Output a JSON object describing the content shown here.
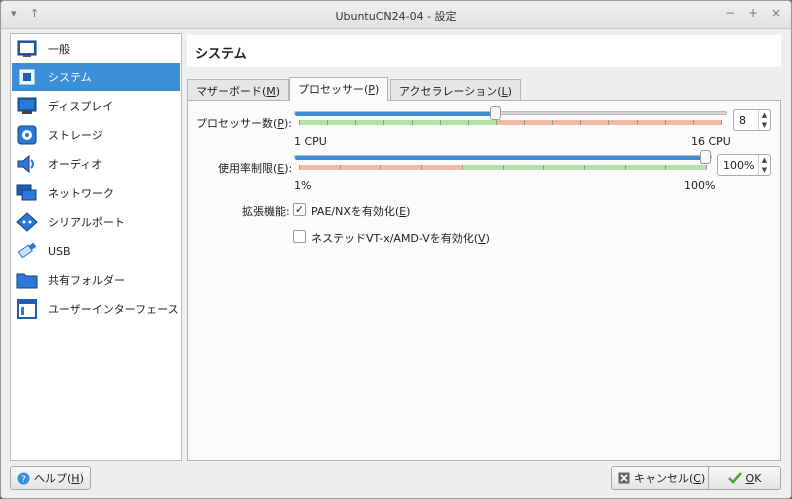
{
  "window": {
    "title": "UbuntuCN24-04 - 設定",
    "controls": {
      "minimize": "−",
      "maximize": "+",
      "close": "×",
      "menu": "▾",
      "up": "↑"
    }
  },
  "sidebar": {
    "items": [
      {
        "label": "一般",
        "icon": "general-icon",
        "selected": false
      },
      {
        "label": "システム",
        "icon": "system-chip-icon",
        "selected": true
      },
      {
        "label": "ディスプレイ",
        "icon": "display-icon",
        "selected": false
      },
      {
        "label": "ストレージ",
        "icon": "storage-disk-icon",
        "selected": false
      },
      {
        "label": "オーディオ",
        "icon": "audio-speaker-icon",
        "selected": false
      },
      {
        "label": "ネットワーク",
        "icon": "network-icon",
        "selected": false
      },
      {
        "label": "シリアルポート",
        "icon": "serial-port-icon",
        "selected": false
      },
      {
        "label": "USB",
        "icon": "usb-icon",
        "selected": false
      },
      {
        "label": "共有フォルダー",
        "icon": "shared-folder-icon",
        "selected": false
      },
      {
        "label": "ユーザーインターフェース",
        "icon": "user-interface-icon",
        "selected": false
      }
    ]
  },
  "header": {
    "title": "システム"
  },
  "tabs": [
    {
      "label": "マザーボード(",
      "mnemonic": "M",
      "suffix": ")",
      "active": false
    },
    {
      "label": "プロセッサー(",
      "mnemonic": "P",
      "suffix": ")",
      "active": true
    },
    {
      "label": "アクセラレーション(",
      "mnemonic": "L",
      "suffix": ")",
      "active": false
    }
  ],
  "processor": {
    "label": "プロセッサー数(",
    "mnemonic": "P",
    "suffix": "):",
    "value": "8",
    "min_label": "1 CPU",
    "max_label": "16 CPU",
    "min": 1,
    "max": 16,
    "current": 8
  },
  "execution_cap": {
    "label": "使用率制限(",
    "mnemonic": "E",
    "suffix": "):",
    "value": "100%",
    "min_label": "1%",
    "max_label": "100%",
    "min": 1,
    "max": 100,
    "current": 100
  },
  "extended": {
    "label": "拡張機能:",
    "pae": {
      "label": "PAE/NXを有効化(",
      "mnemonic": "E",
      "suffix": ")",
      "checked": true,
      "mark": "✓"
    },
    "nested": {
      "label": "ネステッドVT-x/AMD-Vを有効化(",
      "mnemonic": "V",
      "suffix": ")",
      "checked": false
    }
  },
  "footer": {
    "help": {
      "label": "ヘルプ(",
      "mnemonic": "H",
      "suffix": ")"
    },
    "cancel": {
      "label": "キャンセル(",
      "mnemonic": "C",
      "suffix": ")"
    },
    "ok": {
      "label": "",
      "mnemonic": "O",
      "suffix": "K"
    }
  },
  "colors": {
    "accent": "#3b8ed8",
    "zone_green": "#aee6a4",
    "zone_red": "#f4b9a4"
  }
}
